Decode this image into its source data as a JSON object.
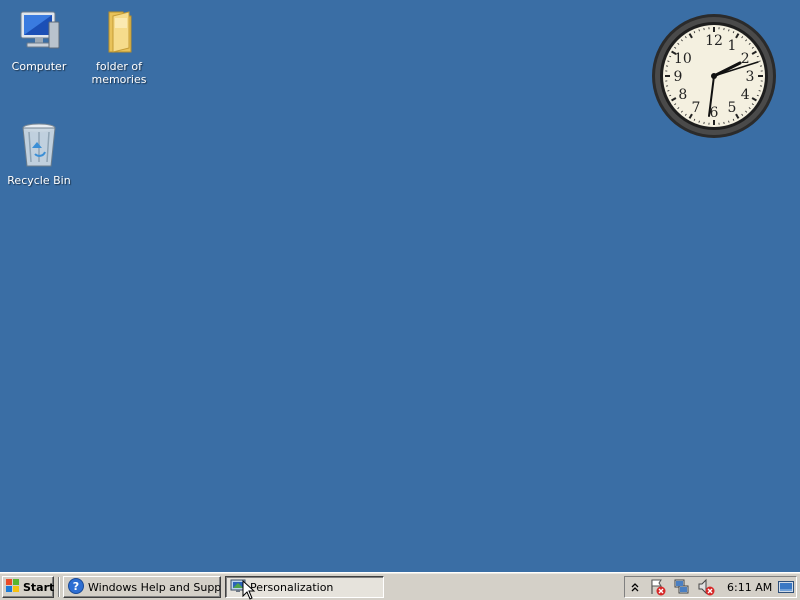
{
  "desktop": {
    "background_color": "#3a6ea5",
    "icons": [
      {
        "label": "Computer",
        "icon": "computer-icon"
      },
      {
        "label": "folder of memories",
        "icon": "folder-icon"
      },
      {
        "label": "Recycle Bin",
        "icon": "recycle-bin-icon"
      }
    ]
  },
  "clock_gadget": {
    "numerals": [
      "12",
      "1",
      "2",
      "3",
      "4",
      "5",
      "6",
      "7",
      "8",
      "9",
      "10"
    ],
    "time_shown": "2:31"
  },
  "taskbar": {
    "start_label": "Start",
    "tasks": [
      {
        "label": "Windows Help and Support",
        "icon": "help-icon",
        "active": false
      },
      {
        "label": "Personalization",
        "icon": "personalization-icon",
        "active": true
      }
    ],
    "tray": {
      "chevron_icon": "chevron-up-icon",
      "icons": [
        "action-center-error-icon",
        "network-error-icon",
        "volume-muted-icon"
      ],
      "time": "6:11 AM",
      "show_desktop_icon": "show-desktop-icon"
    }
  }
}
